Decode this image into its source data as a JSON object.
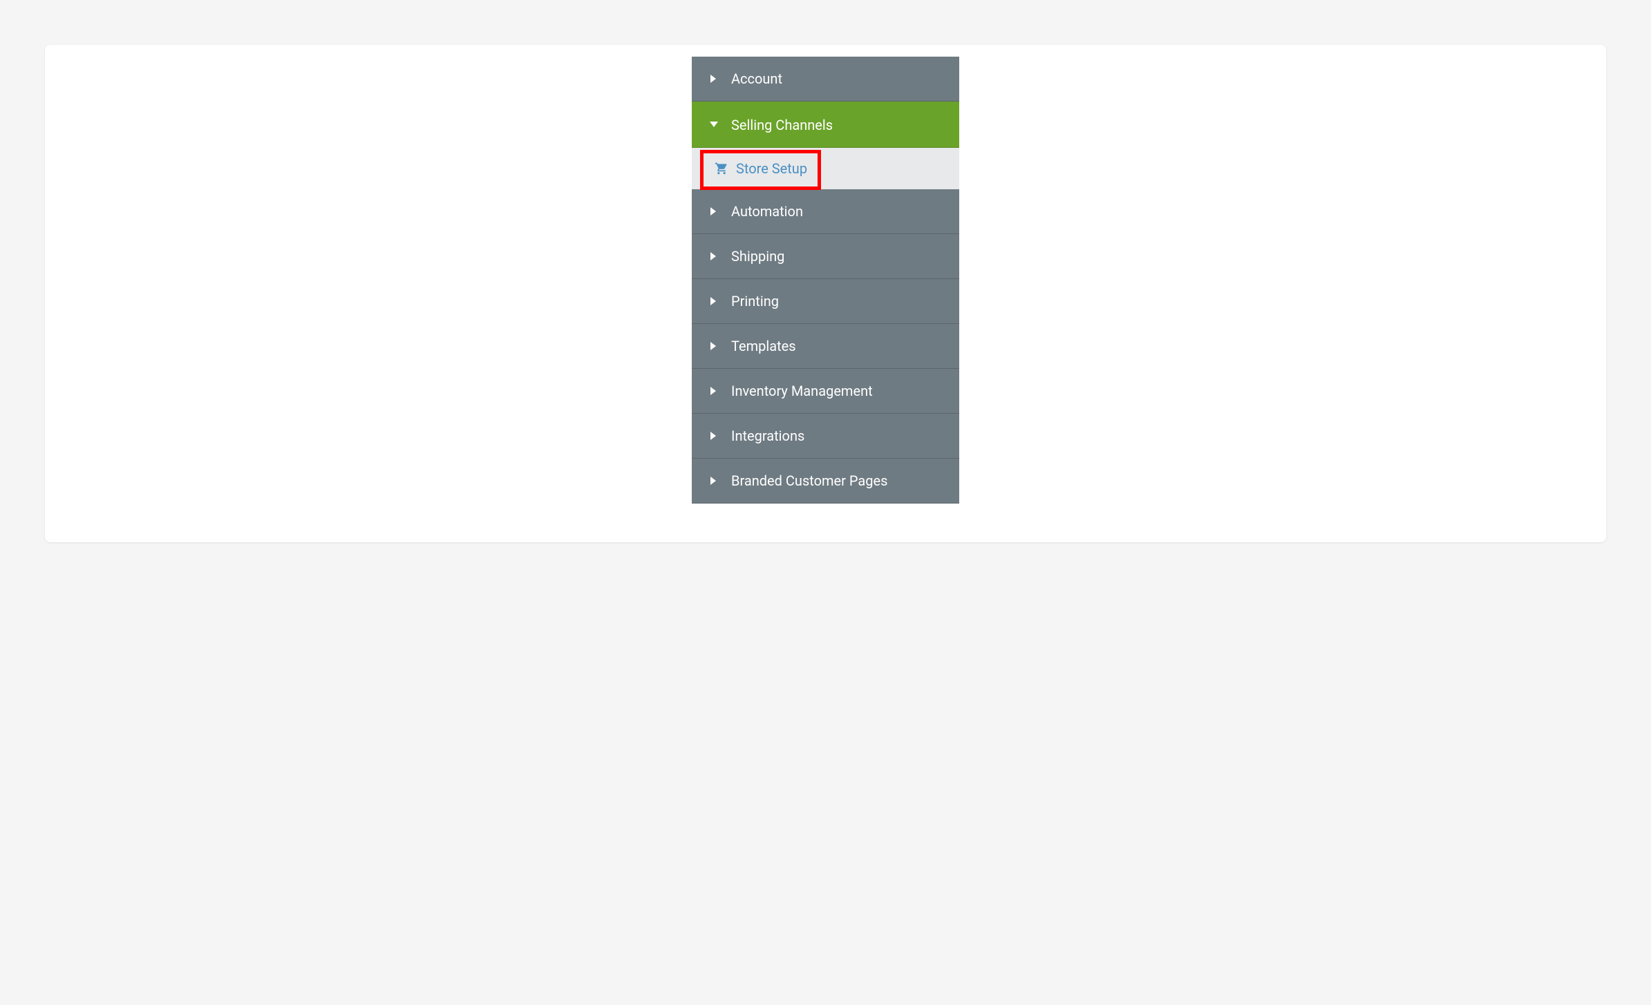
{
  "sidebar": {
    "items": [
      {
        "label": "Account",
        "expanded": false
      },
      {
        "label": "Selling Channels",
        "expanded": true,
        "subitems": [
          {
            "label": "Store Setup",
            "icon": "cart",
            "highlighted": true
          }
        ]
      },
      {
        "label": "Automation",
        "expanded": false
      },
      {
        "label": "Shipping",
        "expanded": false
      },
      {
        "label": "Printing",
        "expanded": false
      },
      {
        "label": "Templates",
        "expanded": false
      },
      {
        "label": "Inventory Management",
        "expanded": false
      },
      {
        "label": "Integrations",
        "expanded": false
      },
      {
        "label": "Branded Customer Pages",
        "expanded": false
      }
    ]
  },
  "colors": {
    "sidebar_bg": "#6f7b82",
    "active_bg": "#6aa329",
    "submenu_bg": "#e8e9ea",
    "link": "#4a90c5",
    "highlight_border": "#ff0000"
  }
}
